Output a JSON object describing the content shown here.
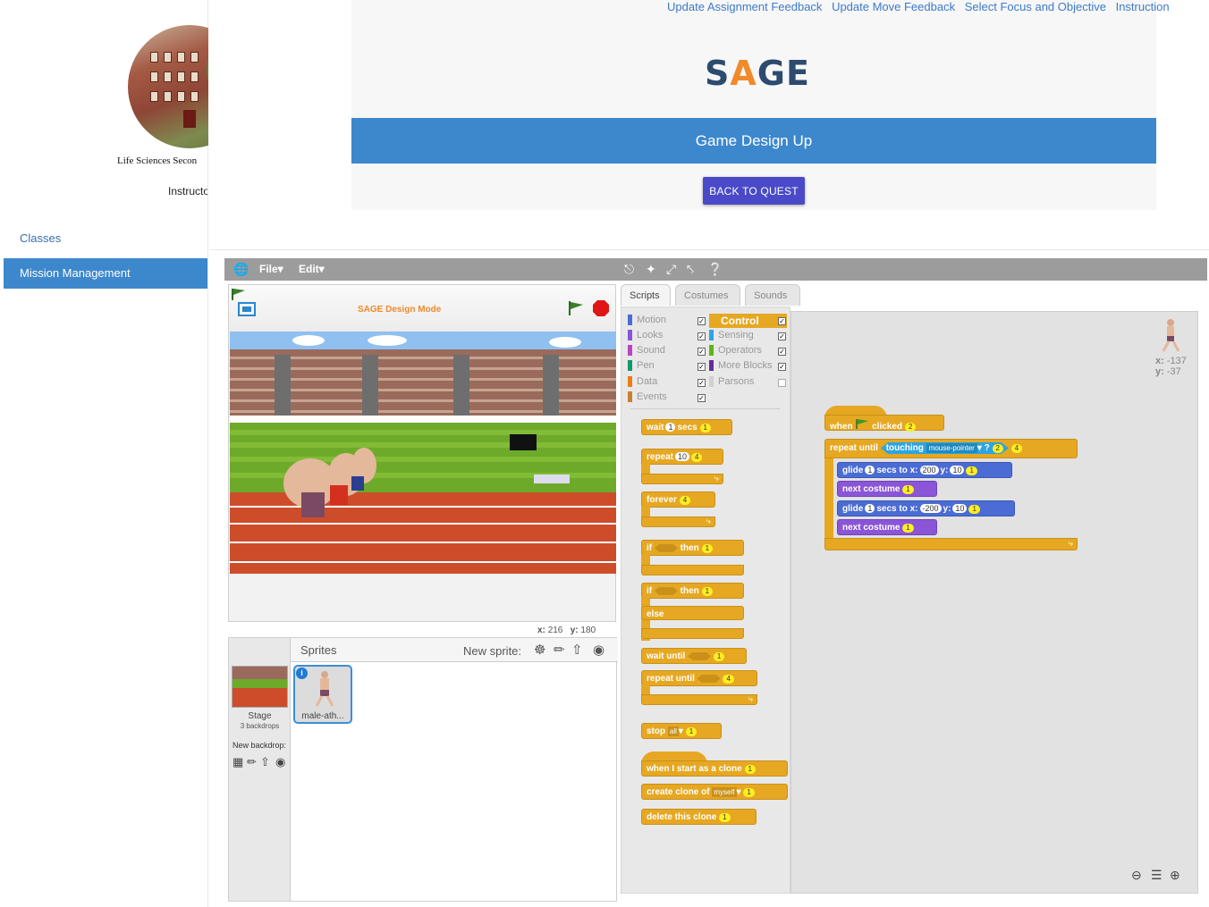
{
  "sidebar": {
    "school_name": "Life Sciences Secon",
    "instructor_label": "Instructo",
    "nav": [
      {
        "label": "Classes",
        "active": false
      },
      {
        "label": "Mission Management",
        "active": true
      }
    ]
  },
  "top_links": [
    "Update Assignment Feedback",
    "Update Move Feedback",
    "Select Focus and Objective",
    "Instruction"
  ],
  "brand": "SAGE",
  "quest_title": "Game Design Up",
  "back_button": "BACK TO QUEST",
  "scratch": {
    "menu": {
      "file": "File",
      "edit": "Edit"
    },
    "stage_title": "SAGE Design Mode",
    "stage_coords": {
      "x_label": "x:",
      "x": "216",
      "y_label": "y:",
      "y": "180"
    },
    "sprite_coords": {
      "x_label": "x:",
      "x": "-137",
      "y_label": "y:",
      "y": "-37"
    },
    "tabs": [
      "Scripts",
      "Costumes",
      "Sounds"
    ],
    "active_tab": "Scripts",
    "sprites": {
      "header": "Sprites",
      "new_sprite": "New sprite:",
      "stage_label": "Stage",
      "backdrops_count": "3 backdrops",
      "new_backdrop": "New backdrop:",
      "sprite_name": "male-ath..."
    },
    "categories_left": [
      {
        "label": "Motion",
        "color": "#4a6cd4"
      },
      {
        "label": "Looks",
        "color": "#8a55d7"
      },
      {
        "label": "Sound",
        "color": "#bb42c3"
      },
      {
        "label": "Pen",
        "color": "#0e9a6c"
      },
      {
        "label": "Data",
        "color": "#ee7d16"
      },
      {
        "label": "Events",
        "color": "#c88330"
      }
    ],
    "categories_right": [
      {
        "label": "Control",
        "color": "#e6a822"
      },
      {
        "label": "Sensing",
        "color": "#2ca5e2"
      },
      {
        "label": "Operators",
        "color": "#5cb712"
      },
      {
        "label": "More Blocks",
        "color": "#632d99"
      },
      {
        "label": "Parsons",
        "color": "#d0d0d0"
      }
    ],
    "palette_blocks": {
      "wait": "wait",
      "wait_num": "1",
      "secs": "secs",
      "wait_pts": "1",
      "repeat": "repeat",
      "repeat_num": "10",
      "repeat_pts": "4",
      "forever": "forever",
      "forever_pts": "4",
      "if": "if",
      "then": "then",
      "if_pts": "1",
      "if2": "if",
      "then2": "then",
      "if2_pts": "1",
      "else": "else",
      "wait_until": "wait until",
      "wait_until_pts": "1",
      "repeat_until": "repeat until",
      "repeat_until_pts": "4",
      "stop": "stop",
      "stop_opt": "all",
      "stop_pts": "1",
      "when_clone": "when I start as a clone",
      "when_clone_pts": "1",
      "create_clone": "create clone of",
      "create_clone_opt": "myself",
      "create_clone_pts": "1",
      "delete_clone": "delete this clone",
      "delete_clone_pts": "1"
    },
    "script": {
      "when": "when",
      "clicked": "clicked",
      "hat_pts": "2",
      "repeat_until": "repeat until",
      "touching": "touching",
      "touch_opt": "mouse-pointer",
      "q": "?",
      "touch_pts": "2",
      "repeat_pts": "4",
      "glide": "glide",
      "secs_to_x": "secs to x:",
      "y_label": "y:",
      "glide1": {
        "secs": "1",
        "x": "200",
        "y": "10",
        "pts": "1"
      },
      "next_costume": "next costume",
      "nc1_pts": "1",
      "glide2": {
        "secs": "1",
        "x": "-200",
        "y": "10",
        "pts": "1"
      },
      "nc2_pts": "1"
    }
  }
}
